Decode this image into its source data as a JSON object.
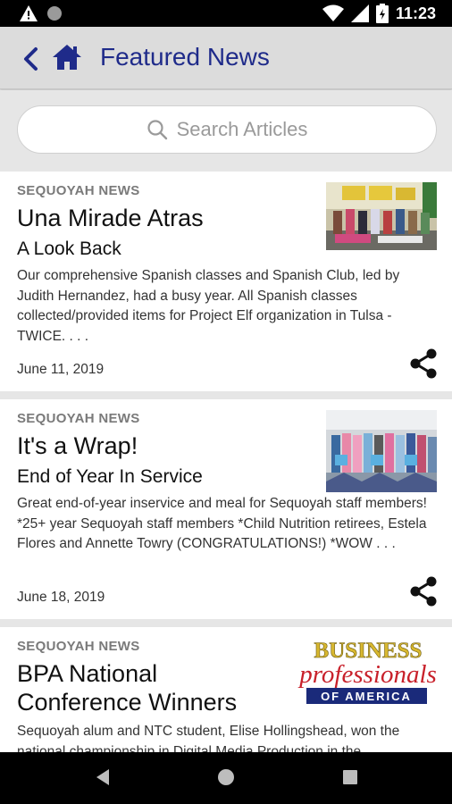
{
  "status_bar": {
    "time": "11:23",
    "icons": [
      "warning-icon",
      "circle-icon",
      "wifi-icon",
      "signal-icon",
      "battery-icon"
    ]
  },
  "app_bar": {
    "title": "Featured News",
    "icons": [
      "back-icon",
      "home-icon"
    ],
    "color": "#1f2b8a"
  },
  "search": {
    "placeholder": "Search Articles"
  },
  "articles": [
    {
      "source": "SEQUOYAH NEWS",
      "headline": "Una Mirade Atras",
      "subhead": "A Look Back",
      "excerpt": "Our comprehensive Spanish classes and Spanish Club, led by Judith Hernandez, had a busy year. All Spanish classes collected/provided items for Project Elf organization in Tulsa - TWICE. . . .",
      "date": "June 11, 2019"
    },
    {
      "source": "SEQUOYAH NEWS",
      "headline": "It's a Wrap!",
      "subhead": "End of Year In Service",
      "excerpt": "Great end-of-year inservice and meal for Sequoyah staff members! *25+ year Sequoyah staff members *Child Nutrition retirees, Estela Flores and Annette Towry (CONGRATULATIONS!) *WOW . . .",
      "date": "June 18, 2019"
    },
    {
      "source": "SEQUOYAH NEWS",
      "headline": "BPA National Conference Winners",
      "excerpt": "Sequoyah alum and NTC student, Elise Hollingshead, won the national championship in Digital Media Production in the",
      "logo": {
        "line1": "BUSINESS",
        "line2": "professionals",
        "line3": "OF AMERICA"
      }
    }
  ],
  "nav_bar": {
    "icons": [
      "back-triangle-icon",
      "home-circle-icon",
      "recents-square-icon"
    ]
  }
}
